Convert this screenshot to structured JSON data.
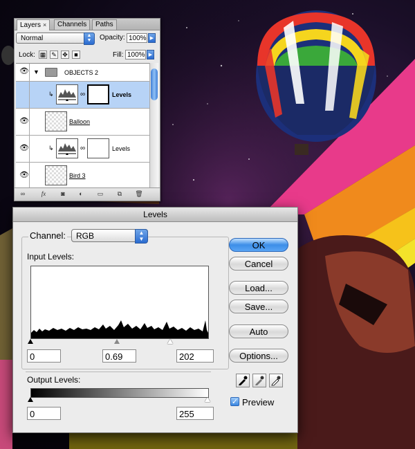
{
  "layers_panel": {
    "tabs": [
      "Layers",
      "Channels",
      "Paths"
    ],
    "close_glyph": "×",
    "blend_mode": "Normal",
    "opacity_label": "Opacity:",
    "opacity_value": "100%",
    "lock_label": "Lock:",
    "fill_label": "Fill:",
    "fill_value": "100%",
    "layers": [
      {
        "name": "OBJECTS 2",
        "type": "group"
      },
      {
        "name": "Levels",
        "type": "adjustment",
        "selected": true
      },
      {
        "name": "Balloon",
        "type": "pixel"
      },
      {
        "name": "Levels",
        "type": "adjustment"
      },
      {
        "name": "Bird 3",
        "type": "pixel"
      }
    ],
    "footer_icons": [
      "link-icon",
      "fx-icon",
      "mask-icon",
      "adjustment-icon",
      "folder-icon",
      "new-layer-icon",
      "trash-icon"
    ]
  },
  "levels_dialog": {
    "title": "Levels",
    "channel_label": "Channel:",
    "channel_value": "RGB",
    "input_levels_label": "Input Levels:",
    "input_black": "0",
    "input_gamma": "0.69",
    "input_white": "202",
    "output_levels_label": "Output Levels:",
    "output_black": "0",
    "output_white": "255",
    "buttons": {
      "ok": "OK",
      "cancel": "Cancel",
      "load": "Load...",
      "save": "Save...",
      "auto": "Auto",
      "options": "Options..."
    },
    "preview_label": "Preview",
    "preview_checked": true,
    "accent_color": "#3c8ee8"
  }
}
